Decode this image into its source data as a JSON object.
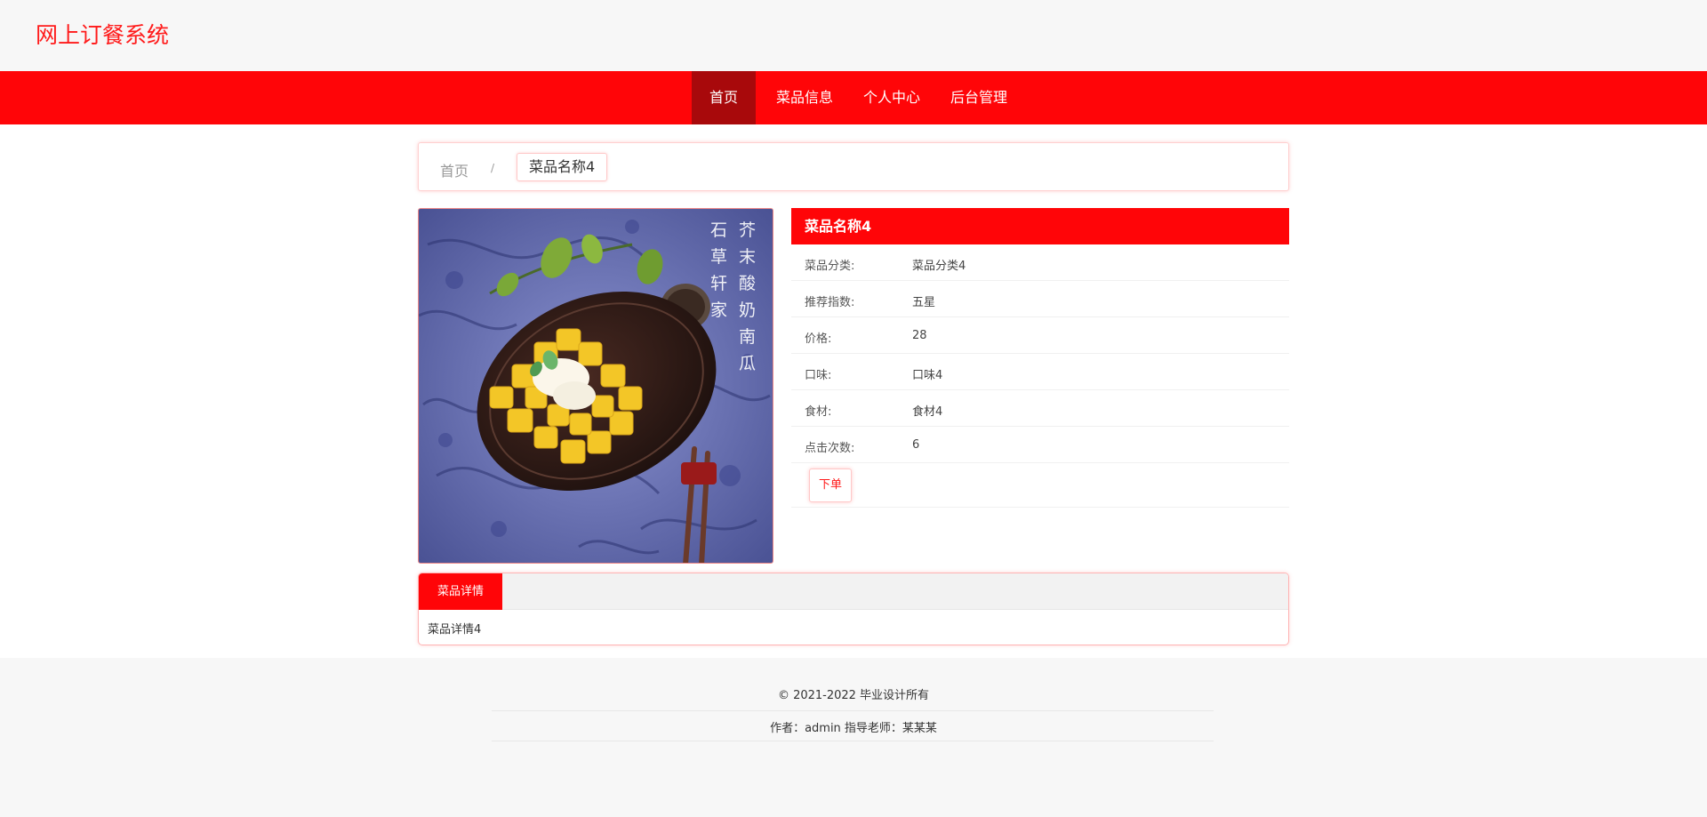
{
  "header": {
    "site_title": "网上订餐系统"
  },
  "nav": {
    "items": [
      {
        "label": "首页",
        "active": true
      },
      {
        "label": "菜品信息",
        "active": false
      },
      {
        "label": "个人中心",
        "active": false
      },
      {
        "label": "后台管理",
        "active": false
      }
    ]
  },
  "breadcrumb": {
    "home": "首页",
    "separator": "/",
    "current": "菜品名称4"
  },
  "photo": {
    "alt": "dish photo",
    "calligraphy_right": "芥末酸奶南瓜",
    "calligraphy_left": "石草轩家"
  },
  "dish": {
    "name": "菜品名称4",
    "fields": [
      {
        "label": "菜品分类:",
        "value": "菜品分类4"
      },
      {
        "label": "推荐指数:",
        "value": "五星"
      },
      {
        "label": "价格:",
        "value": "28"
      },
      {
        "label": "口味:",
        "value": "口味4"
      },
      {
        "label": "食材:",
        "value": "食材4"
      },
      {
        "label": "点击次数:",
        "value": "6"
      }
    ],
    "order_button": "下单"
  },
  "detail": {
    "tab_label": "菜品详情",
    "content": "菜品详情4"
  },
  "footer": {
    "copyright": "© 2021-2022 毕业设计所有",
    "author_line": "作者：admin 指导老师：某某某"
  },
  "colors": {
    "primary": "#ff0508",
    "primary_dark": "#a8090b",
    "title": "#ff1a1a",
    "background_light": "#f7f7f7"
  }
}
